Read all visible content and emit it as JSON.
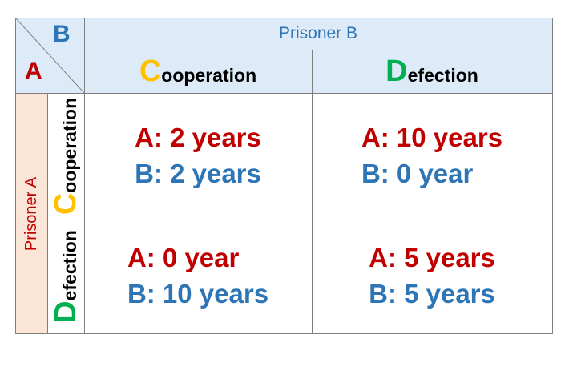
{
  "corner": {
    "col_player": "B",
    "row_player": "A"
  },
  "column_title": "Prisoner B",
  "row_title": "Prisoner A",
  "columns": [
    {
      "initial": "C",
      "rest": "ooperation",
      "initial_color": "#ffc000"
    },
    {
      "initial": "D",
      "rest": "efection",
      "initial_color": "#00b050"
    }
  ],
  "rows": [
    {
      "initial": "C",
      "rest": "ooperation",
      "initial_color": "#ffc000"
    },
    {
      "initial": "D",
      "rest": "efection",
      "initial_color": "#00b050"
    }
  ],
  "payoffs": [
    [
      {
        "a": "A: 2 years",
        "b": "B: 2 years"
      },
      {
        "a": "A: 10 years",
        "b": "B: 0 year"
      }
    ],
    [
      {
        "a": "A: 0 year",
        "b": "B: 10 years"
      },
      {
        "a": "A: 5 years",
        "b": "B: 5 years"
      }
    ]
  ],
  "colors": {
    "header_fill": "#dcebf7",
    "row_title_fill": "#fbe5d6",
    "grid": "#7f7f7f",
    "player_a": "#c00000",
    "player_b": "#2e75b6"
  }
}
